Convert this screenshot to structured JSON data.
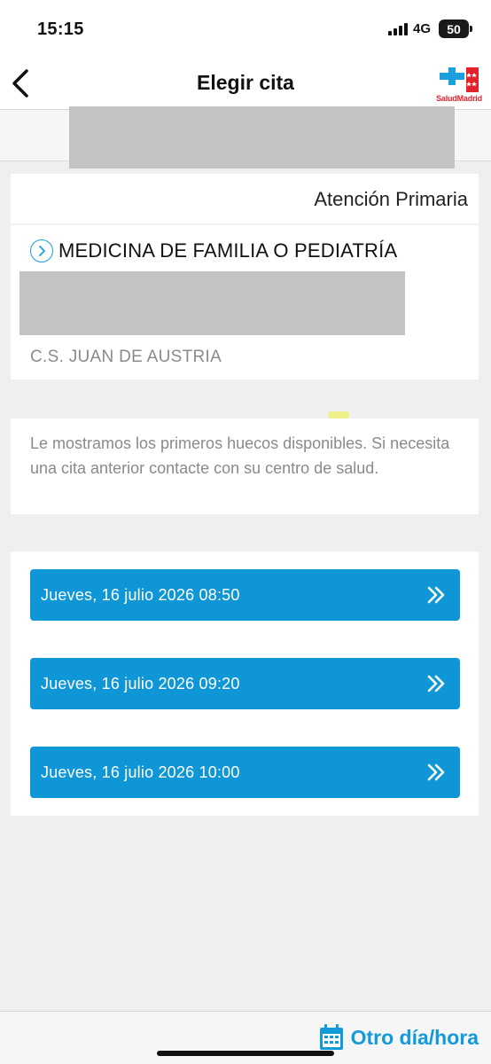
{
  "status_bar": {
    "time": "15:15",
    "network": "4G",
    "battery": "50"
  },
  "nav": {
    "title": "Elegir cita",
    "logo_text": "SaludMadrid"
  },
  "service": {
    "type": "Atención Primaria",
    "name": "MEDICINA DE FAMILIA O PEDIATRÍA",
    "center": "C.S. JUAN DE AUSTRIA"
  },
  "notice": {
    "text": "Le mostramos los primeros huecos disponibles. Si necesita una cita anterior contacte con su centro de salud."
  },
  "slots": [
    {
      "label": "Jueves, 16 julio 2026 08:50"
    },
    {
      "label": "Jueves, 16 julio 2026 09:20"
    },
    {
      "label": "Jueves, 16 julio 2026 10:00"
    }
  ],
  "bottom": {
    "other_day_label": "Otro día/hora"
  },
  "colors": {
    "accent": "#0e96d6",
    "brand_red": "#e2232c"
  }
}
